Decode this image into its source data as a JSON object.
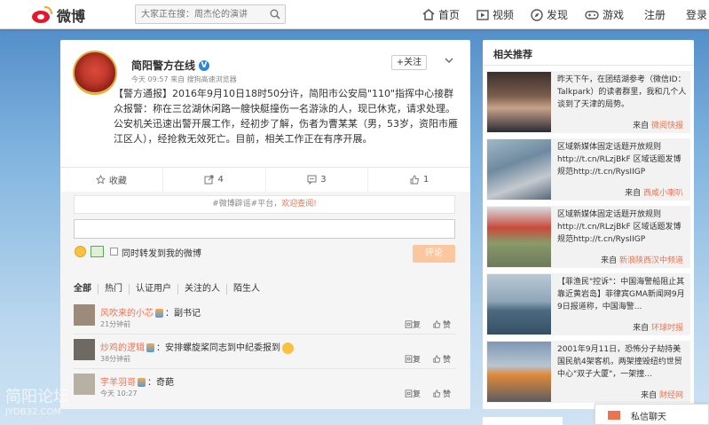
{
  "topbar": {
    "logo_text": "微博",
    "search_placeholder": "大家正在搜：周杰伦的演讲",
    "nav": [
      {
        "label": "首页"
      },
      {
        "label": "视频"
      },
      {
        "label": "发现"
      },
      {
        "label": "游戏"
      },
      {
        "label": "注册"
      },
      {
        "label": "登录"
      }
    ]
  },
  "post": {
    "author": "简阳警方在线",
    "verified_badge": "V",
    "meta": "今天 09:57 来自 搜狗高速浏览器",
    "follow_label": "+关注",
    "content": "【警方通报】2016年9月10日18时50分许，简阳市公安局\"110\"指挥中心接群众报警：称在三岔湖休闲路一艘快艇撞伤一名游泳的人，现已休克，请求处理。公安机关迅速出警开展工作，经初步了解，伤者为曹某某（男，53岁，资阳市雁江区人），经抢救无效死亡。目前，相关工作正在有序开展。",
    "actions": [
      {
        "icon": "star-icon",
        "label": "收藏"
      },
      {
        "icon": "share-icon",
        "label": "4"
      },
      {
        "icon": "comment-icon",
        "label": "3"
      },
      {
        "icon": "like-icon",
        "label": "1"
      }
    ]
  },
  "comments": {
    "tip_prefix": "#微博辟谣#平台，",
    "tip_link": "欢迎查阅!",
    "input_value": "",
    "sync_label": "同时转发到我的微博",
    "submit_label": "评论",
    "tabs": [
      "全部",
      "热门",
      "认证用户",
      "关注的人",
      "陌生人"
    ],
    "items": [
      {
        "name": "风吹来的小芯",
        "text": "：副书记",
        "time": "21分钟前",
        "reply": "回复",
        "like": "赞"
      },
      {
        "name": "炒鸡的逻辑",
        "text": "：安排螺旋桨同志到中纪委报到",
        "time": "38分钟前",
        "reply": "回复",
        "like": "赞"
      },
      {
        "name": "宇羊羽哥",
        "text": "：奇葩",
        "time": "今天 10:27",
        "reply": "回复",
        "like": "赞"
      }
    ]
  },
  "sidebar": {
    "title": "相关推荐",
    "cards": [
      {
        "text": "昨天下午，在团结湖参考（微信ID：Talkpark）的读者群里，我和几个人谈到了天津的局势。",
        "src_prefix": "来自",
        "src": "微阅快报"
      },
      {
        "text": "区域新媒体固定话题开放规则 http://t.cn/RLzjBkF 区域话题发博规范http://t.cn/RysIIGP",
        "src_prefix": "来自",
        "src": "西咸小喇叭"
      },
      {
        "text": "区域新媒体固定话题开放规则 http://t.cn/RLzjBkF 区域话题发博规范http://t.cn/RysIIGP",
        "src_prefix": "来自",
        "src": "新浪陕西汉中频道"
      },
      {
        "text": "【菲渔民\"控诉\"：中国海警船阻止其靠近黄岩岛】菲律宾GMA新闻网9月9日报道称，中国海警...",
        "src_prefix": "来自",
        "src": "环球时报"
      },
      {
        "text": "2001年9月11日，恐怖分子劫持美国民航4架客机，两架撞毁纽约世贸中心\"双子大厦\"，一架撞...",
        "src_prefix": "来自",
        "src": "财经网"
      }
    ]
  },
  "private_message": {
    "label": "私信聊天"
  },
  "watermark": {
    "line1": "简阳论坛",
    "line2": "JYDB32.COM"
  }
}
